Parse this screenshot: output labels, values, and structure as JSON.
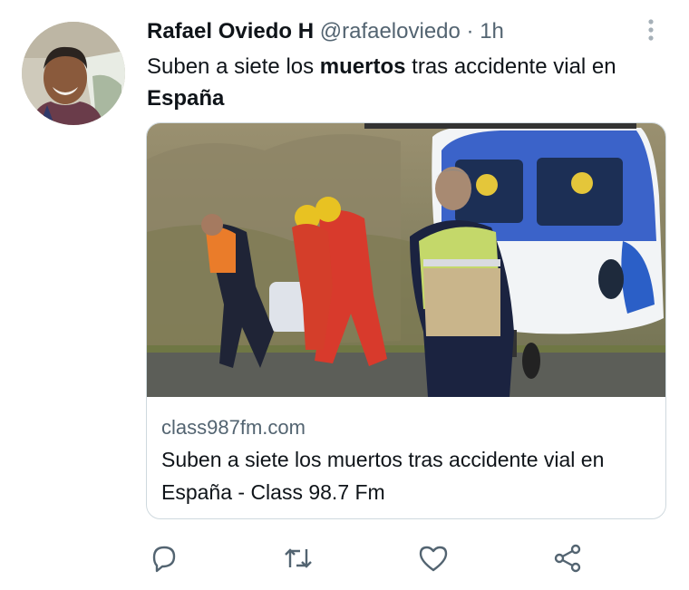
{
  "tweet": {
    "author_name": "Rafael Oviedo H",
    "handle": "@rafaeloviedo",
    "separator": "·",
    "time": "1h",
    "text_parts": [
      "Suben a siete los ",
      "muertos",
      " tras accidente vial en ",
      "España"
    ]
  },
  "card": {
    "domain": "class987fm.com",
    "title": "Suben a siete los muertos tras accidente vial en España - Class 98.7 Fm"
  },
  "icons": {
    "more": "more-vertical-icon",
    "reply": "reply-icon",
    "retweet": "retweet-icon",
    "like": "heart-icon",
    "share": "share-icon"
  },
  "colors": {
    "text": "#0f1419",
    "secondary": "#536471",
    "border": "#cfd9de",
    "helicopter_blue": "#2b5fc7"
  }
}
